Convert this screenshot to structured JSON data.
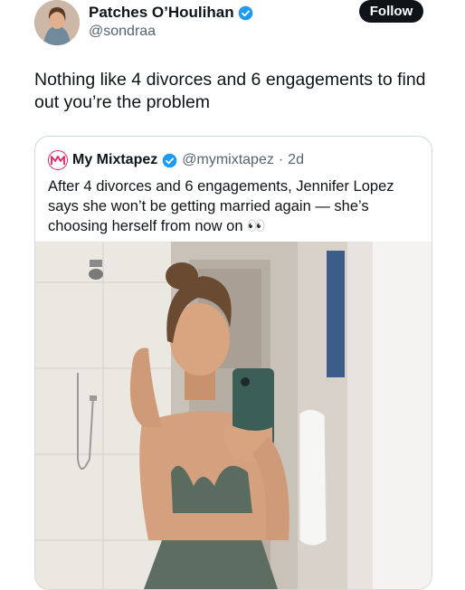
{
  "author": {
    "display_name": "Patches O’Houlihan",
    "handle": "@sondraa",
    "verified_icon": "verified-badge-icon",
    "avatar": "profile-photo"
  },
  "follow_button": {
    "label": "Follow"
  },
  "tweet": {
    "text": "Nothing like 4 divorces and 6 engagements to find out you’re the problem"
  },
  "quote": {
    "display_name": "My Mixtapez",
    "handle": "@mymixtapez",
    "separator": "·",
    "time": "2d",
    "text": "After 4 divorces and 6 engagements, Jennifer Lopez says she won’t be getting married again — she’s choosing herself from now on 👀",
    "image": "bathroom-mirror-selfie-photo"
  },
  "colors": {
    "verified_blue": "#1d9bf0",
    "text_primary": "#0f1419",
    "text_secondary": "#536471",
    "border": "#cfd9de",
    "follow_bg": "#0f1419"
  }
}
